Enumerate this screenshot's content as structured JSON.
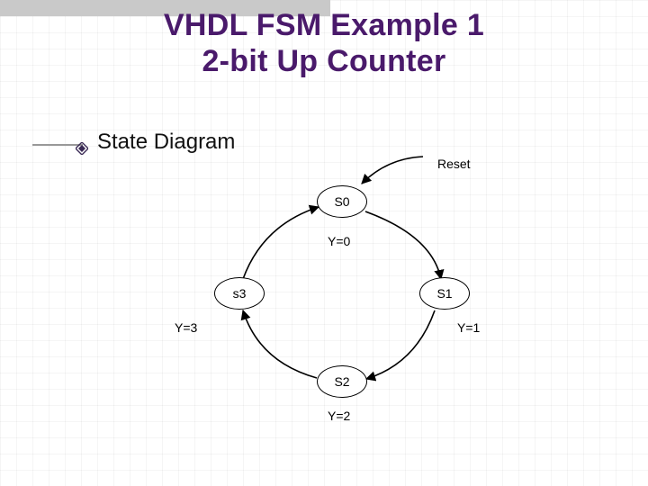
{
  "title": {
    "line1": "VHDL FSM Example 1",
    "line2": "2-bit Up Counter"
  },
  "bullet": {
    "label": "State Diagram"
  },
  "diagram": {
    "states": {
      "s0": "S0",
      "s1": "S1",
      "s2": "S2",
      "s3": "s3"
    },
    "outputs": {
      "y0": "Y=0",
      "y1": "Y=1",
      "y2": "Y=2",
      "y3": "Y=3"
    },
    "reset_label": "Reset"
  }
}
